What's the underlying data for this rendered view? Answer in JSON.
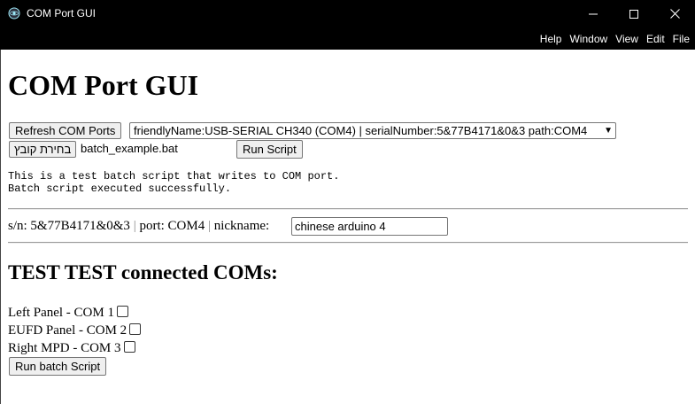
{
  "window": {
    "title": "COM Port GUI",
    "minimize_glyph": "—",
    "close_glyph": "✕"
  },
  "menu": [
    "File",
    "Edit",
    "View",
    "Window",
    "Help"
  ],
  "page": {
    "heading": "COM Port GUI",
    "refresh_button": "Refresh COM Ports",
    "port_select_value": "friendlyName:USB-SERIAL CH340 (COM4) | serialNumber:5&77B4171&0&3 path:COM4",
    "choose_file_button": "בחירת קובץ",
    "file_name": "batch_example.bat",
    "run_script_button": "Run Script",
    "output_lines": [
      "This is a test batch script that writes to COM port.",
      "Batch script executed successfully."
    ],
    "device": {
      "sn_label": "s/n: 5&77B4171&0&3",
      "separator": "|",
      "port_label": "port: COM4",
      "nickname_label": "nickname:",
      "nickname_value": "chinese arduino 4"
    },
    "connected_heading": "TEST TEST connected COMs:",
    "com_items": [
      {
        "label": "Left Panel - COM 1",
        "checked": false
      },
      {
        "label": "EUFD Panel - COM 2",
        "checked": false
      },
      {
        "label": "Right MPD - COM 3",
        "checked": false
      }
    ],
    "run_batch_button": "Run batch Script"
  }
}
